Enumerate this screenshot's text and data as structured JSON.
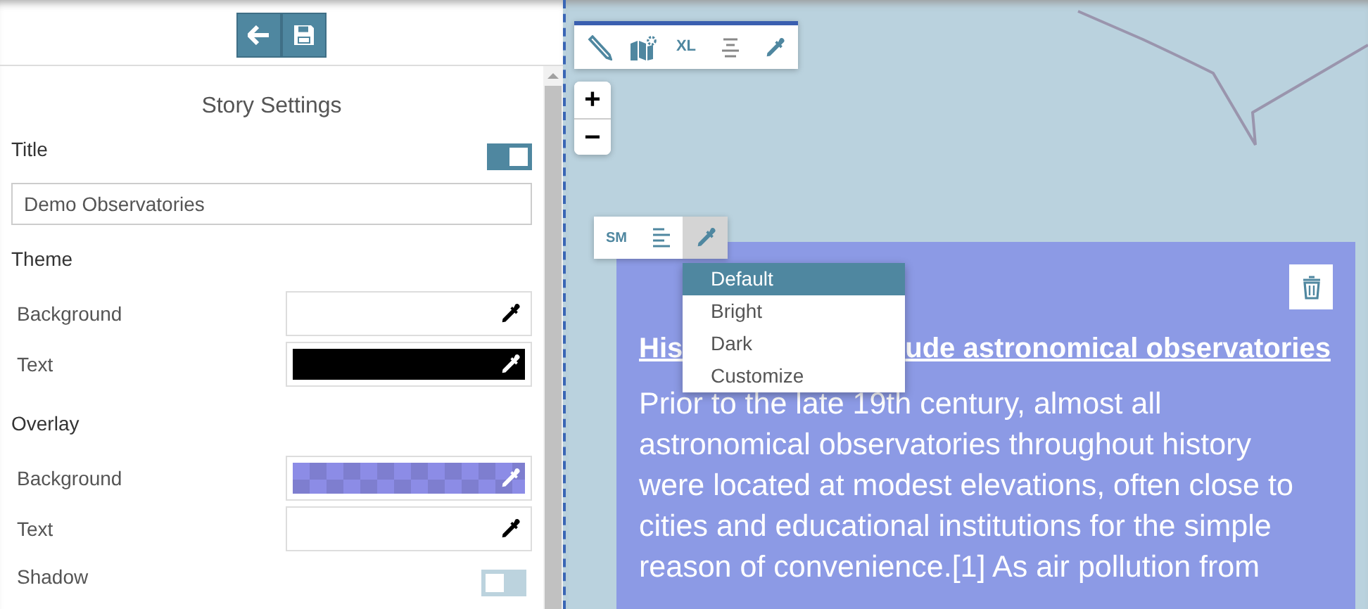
{
  "settings": {
    "heading": "Story Settings",
    "title": {
      "label": "Title",
      "on": true,
      "value": "Demo Observatories"
    },
    "sections": [
      {
        "heading": "Theme",
        "rows": [
          {
            "kind": "color",
            "label": "Background",
            "color": "#ffffff"
          },
          {
            "kind": "color",
            "label": "Text",
            "color": "#000000"
          }
        ]
      },
      {
        "heading": "Overlay",
        "rows": [
          {
            "kind": "translucent",
            "label": "Background",
            "color": "#8c8ce6"
          },
          {
            "kind": "color",
            "label": "Text",
            "color": "#ffffff"
          },
          {
            "kind": "toggle",
            "label": "Shadow",
            "on": false
          }
        ]
      }
    ]
  },
  "map": {
    "toolbar_size": "XL",
    "zoom": [
      "+",
      "−"
    ],
    "story": {
      "size": "SM",
      "color_menu_expanded": true,
      "menu": [
        {
          "label": "Default",
          "selected": true
        },
        {
          "label": "Bright",
          "selected": false
        },
        {
          "label": "Dark",
          "selected": false
        },
        {
          "label": "Customize",
          "selected": false
        }
      ],
      "heading_parts": [
        "His",
        "ude astronomical observatories"
      ],
      "body": "Prior to the late 19th century, almost all astronomical observatories throughout history were located at modest elevations, often close to cities and educational institutions for the simple reason of convenience.[1] As air pollution from"
    }
  }
}
